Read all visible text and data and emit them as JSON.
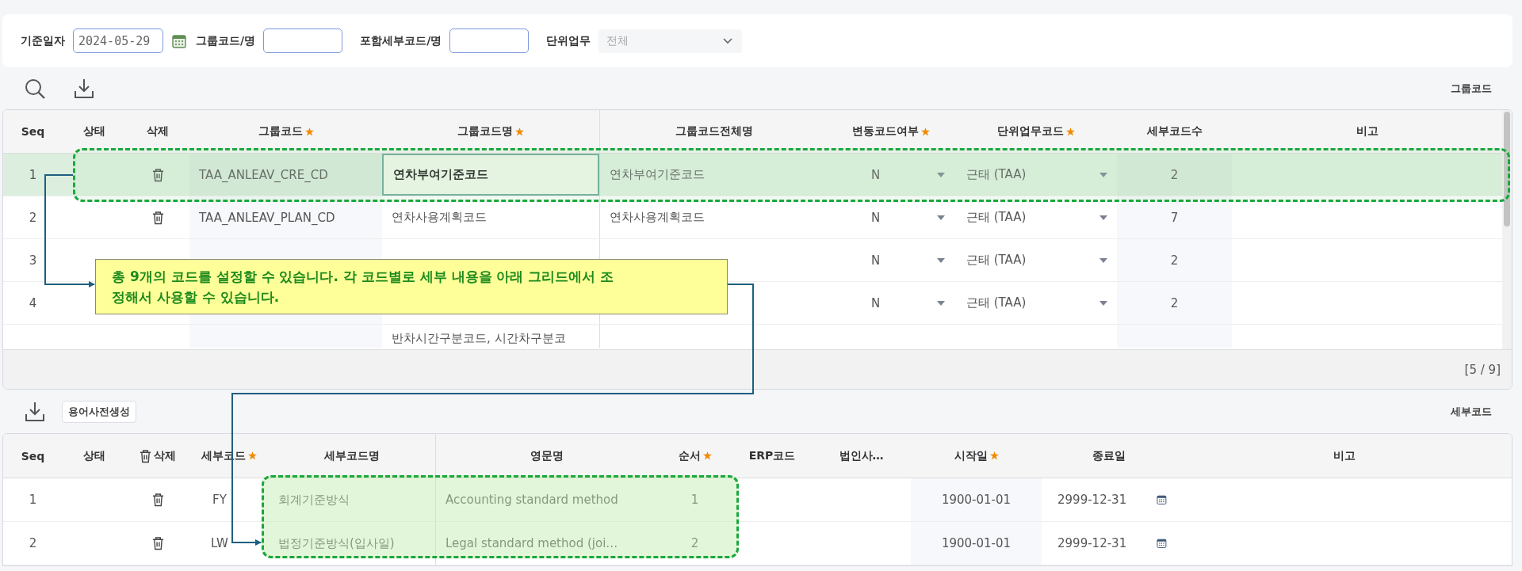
{
  "filter": {
    "fields": [
      {
        "kind": "date",
        "label": "기준일자",
        "value": "2024-05-29"
      },
      {
        "kind": "text",
        "label": "그룹코드/명"
      },
      {
        "kind": "text",
        "label": "포함세부코드/명"
      },
      {
        "kind": "select",
        "label": "단위업무",
        "placeholder": "전체"
      }
    ]
  },
  "group_grid": {
    "title": "그룹코드",
    "tools": [
      {
        "kind": "search"
      },
      {
        "kind": "download"
      }
    ],
    "columns": [
      {
        "label": "Seq",
        "required": false
      },
      {
        "label": "상태",
        "required": false
      },
      {
        "label": "삭제",
        "required": false
      },
      {
        "label": "그룹코드",
        "required": true
      },
      {
        "label": "그룹코드명",
        "required": true
      },
      {
        "label": "그룹코드전체명",
        "required": false
      },
      {
        "label": "변동코드여부",
        "required": true
      },
      {
        "label": "단위업무코드",
        "required": true
      },
      {
        "label": "세부코드수",
        "required": false
      },
      {
        "label": "비고",
        "required": false
      }
    ],
    "rows": [
      {
        "selected": true,
        "seq": "1",
        "delete": true,
        "group_code": "TAA_ANLEAV_CRE_CD",
        "group_name": "연차부여기준코드",
        "full_name": "연차부여기준코드",
        "variable": "N",
        "unit": "근태 (TAA)",
        "detail_count": "2"
      },
      {
        "selected": false,
        "seq": "2",
        "delete": true,
        "group_code": "TAA_ANLEAV_PLAN_CD",
        "group_name": "연차사용계획코드",
        "full_name": "연차사용계획코드",
        "variable": "N",
        "unit": "근태 (TAA)",
        "detail_count": "7"
      },
      {
        "selected": false,
        "seq": "3",
        "variable": "N",
        "unit": "근태 (TAA)",
        "detail_count": "2"
      },
      {
        "selected": false,
        "seq": "4",
        "variable": "N",
        "unit": "근태 (TAA)",
        "detail_count": "2"
      },
      {
        "selected": false,
        "group_name": "반차시간구분코드, 시간차구분코"
      }
    ],
    "counter": "[5 / 9]"
  },
  "detail_grid": {
    "title": "세부코드",
    "tools": [
      {
        "kind": "download"
      },
      {
        "kind": "button",
        "label": "용어사전생성"
      }
    ],
    "columns": [
      {
        "label": "Seq",
        "required": false
      },
      {
        "label": "상태",
        "required": false
      },
      {
        "label": "삭제",
        "required": false,
        "trash_icon": true
      },
      {
        "label": "세부코드",
        "required": true
      },
      {
        "label": "세부코드명",
        "required": false
      },
      {
        "label": "영문명",
        "required": false
      },
      {
        "label": "순서",
        "required": true
      },
      {
        "label": "ERP코드",
        "required": false
      },
      {
        "label": "법인사…",
        "required": false
      },
      {
        "label": "시작일",
        "required": true
      },
      {
        "label": "종료일",
        "required": false
      },
      {
        "label": "비고",
        "required": false
      }
    ],
    "rows": [
      {
        "seq": "1",
        "delete": true,
        "code": "FY",
        "name": "회계기준방식",
        "english": "Accounting standard method",
        "order": "1",
        "start": "1900-01-01",
        "end": "2999-12-31"
      },
      {
        "seq": "2",
        "delete": true,
        "code": "LW",
        "name": "법정기준방식(입사일)",
        "english": "Legal standard method (joi…",
        "order": "2",
        "start": "1900-01-01",
        "end": "2999-12-31"
      }
    ]
  },
  "callout": {
    "text": "총 9개의 코드를 설정할 수 있습니다. 각 코드별로 세부 내용을 아래 그리드에서 조\n정해서 사용할 수 있습니다."
  }
}
